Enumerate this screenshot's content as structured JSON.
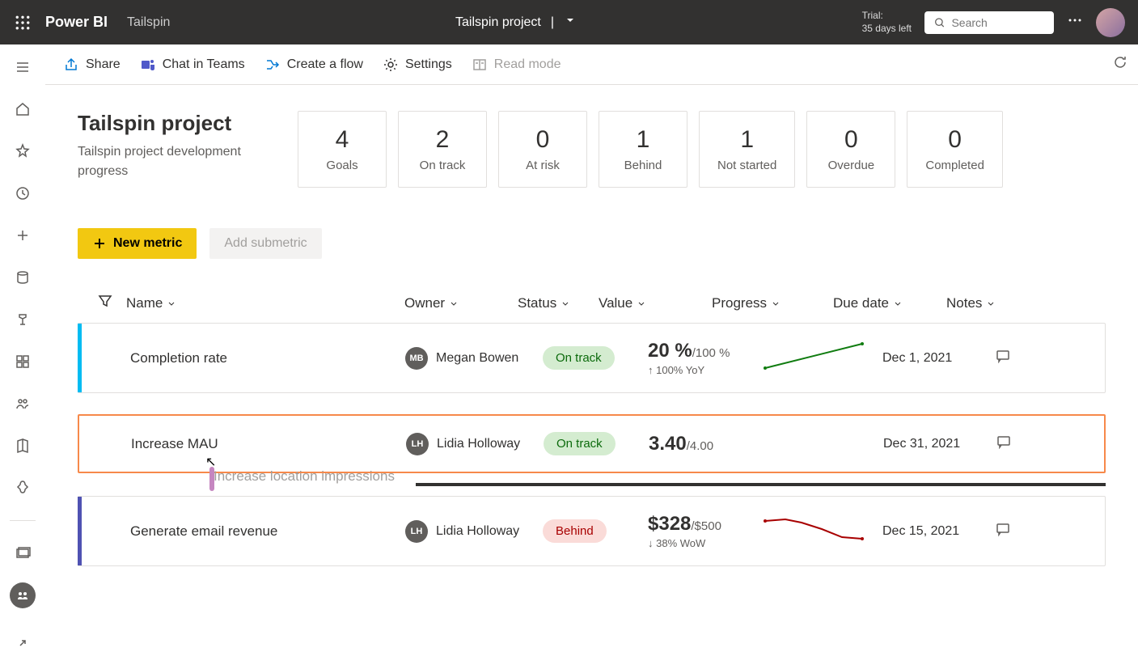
{
  "header": {
    "app_name": "Power BI",
    "workspace": "Tailspin",
    "project": "Tailspin project",
    "trial_label": "Trial:",
    "trial_days": "35 days left",
    "search_placeholder": "Search"
  },
  "toolbar": {
    "share": "Share",
    "chat": "Chat in Teams",
    "flow": "Create a flow",
    "settings": "Settings",
    "readmode": "Read mode"
  },
  "page": {
    "title": "Tailspin project",
    "subtitle": "Tailspin project development progress"
  },
  "stats": [
    {
      "value": "4",
      "label": "Goals"
    },
    {
      "value": "2",
      "label": "On track"
    },
    {
      "value": "0",
      "label": "At risk"
    },
    {
      "value": "1",
      "label": "Behind"
    },
    {
      "value": "1",
      "label": "Not started"
    },
    {
      "value": "0",
      "label": "Overdue"
    },
    {
      "value": "0",
      "label": "Completed"
    }
  ],
  "actions": {
    "new_metric": "New metric",
    "add_submetric": "Add submetric"
  },
  "columns": {
    "name": "Name",
    "owner": "Owner",
    "status": "Status",
    "value": "Value",
    "progress": "Progress",
    "duedate": "Due date",
    "notes": "Notes"
  },
  "rows": [
    {
      "name": "Completion rate",
      "owner_initials": "MB",
      "owner_name": "Megan Bowen",
      "status": "On track",
      "status_class": "ontrack",
      "value_main": "20 %",
      "value_target": "/100 %",
      "value_delta": "100% YoY",
      "delta_dir": "up",
      "duedate": "Dec 1, 2021",
      "side": "cyan",
      "selected": false
    },
    {
      "name": "Increase MAU",
      "owner_initials": "LH",
      "owner_name": "Lidia Holloway",
      "status": "On track",
      "status_class": "ontrack",
      "value_main": "3.40",
      "value_target": "/4.00",
      "value_delta": "",
      "delta_dir": "",
      "duedate": "Dec 31, 2021",
      "side": "orange",
      "selected": true
    },
    {
      "name": "Generate email revenue",
      "owner_initials": "LH",
      "owner_name": "Lidia Holloway",
      "status": "Behind",
      "status_class": "behind",
      "value_main": "$328",
      "value_target": "/$500",
      "value_delta": "38% WoW",
      "delta_dir": "down",
      "duedate": "Dec 15, 2021",
      "side": "indigo",
      "selected": false
    }
  ],
  "drag": {
    "label": "Increase location impressions"
  }
}
